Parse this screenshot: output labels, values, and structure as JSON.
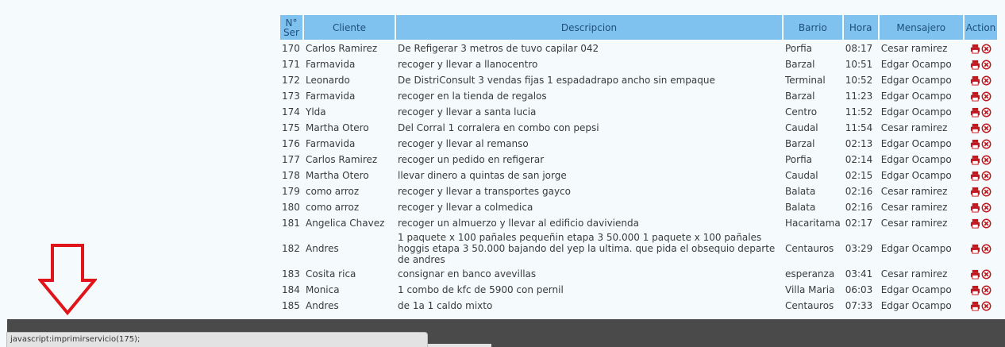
{
  "table": {
    "headers": {
      "ser_line1": "N°",
      "ser_line2": "Ser",
      "cliente": "Cliente",
      "descripcion": "Descripcion",
      "barrio": "Barrio",
      "hora": "Hora",
      "mensajero": "Mensajero",
      "action": "Action"
    },
    "rows": [
      {
        "num": "170",
        "cliente": "Carlos Ramirez",
        "descripcion": "De Refigerar 3 metros de tuvo capilar 042",
        "barrio": "Porfia",
        "hora": "08:17",
        "mensajero": "Cesar ramirez"
      },
      {
        "num": "171",
        "cliente": "Farmavida",
        "descripcion": "recoger y llevar a llanocentro",
        "barrio": "Barzal",
        "hora": "10:51",
        "mensajero": "Edgar Ocampo"
      },
      {
        "num": "172",
        "cliente": "Leonardo",
        "descripcion": "De DistriConsult 3 vendas fijas 1 espadadrapo ancho sin empaque",
        "barrio": "Terminal",
        "hora": "10:52",
        "mensajero": "Edgar Ocampo"
      },
      {
        "num": "173",
        "cliente": "Farmavida",
        "descripcion": "recoger en la tienda de regalos",
        "barrio": "Barzal",
        "hora": "11:23",
        "mensajero": "Edgar Ocampo"
      },
      {
        "num": "174",
        "cliente": "Ylda",
        "descripcion": "recoger y llevar a santa lucia",
        "barrio": "Centro",
        "hora": "11:52",
        "mensajero": "Edgar Ocampo"
      },
      {
        "num": "175",
        "cliente": "Martha Otero",
        "descripcion": "Del Corral 1 corralera en combo con pepsi",
        "barrio": "Caudal",
        "hora": "11:54",
        "mensajero": "Cesar ramirez"
      },
      {
        "num": "176",
        "cliente": "Farmavida",
        "descripcion": "recoger y llevar al remanso",
        "barrio": "Barzal",
        "hora": "02:13",
        "mensajero": "Edgar Ocampo"
      },
      {
        "num": "177",
        "cliente": "Carlos Ramirez",
        "descripcion": "recoger un pedido en refigerar",
        "barrio": "Porfia",
        "hora": "02:14",
        "mensajero": "Edgar Ocampo"
      },
      {
        "num": "178",
        "cliente": "Martha Otero",
        "descripcion": "llevar dinero a quintas de san jorge",
        "barrio": "Caudal",
        "hora": "02:15",
        "mensajero": "Edgar Ocampo"
      },
      {
        "num": "179",
        "cliente": "como arroz",
        "descripcion": "recoger y llevar a transportes gayco",
        "barrio": "Balata",
        "hora": "02:16",
        "mensajero": "Cesar ramirez"
      },
      {
        "num": "180",
        "cliente": "como arroz",
        "descripcion": "recoger y llevar a colmedica",
        "barrio": "Balata",
        "hora": "02:16",
        "mensajero": "Cesar ramirez"
      },
      {
        "num": "181",
        "cliente": "Angelica Chavez",
        "descripcion": "recoger un almuerzo y llevar al edificio davivienda",
        "barrio": "Hacaritama",
        "hora": "02:17",
        "mensajero": "Cesar ramirez"
      },
      {
        "num": "182",
        "cliente": "Andres",
        "descripcion": "1 paquete x 100 pañales pequeñin etapa 3 50.000 1 paquete x 100 pañales hoggis etapa 3 50.000 bajando del yep la ultima. que pida el obsequio departe de andres",
        "barrio": "Centauros",
        "hora": "03:29",
        "mensajero": "Edgar Ocampo"
      },
      {
        "num": "183",
        "cliente": "Cosita rica",
        "descripcion": "consignar en banco avevillas",
        "barrio": "esperanza",
        "hora": "03:41",
        "mensajero": "Cesar ramirez"
      },
      {
        "num": "184",
        "cliente": "Monica",
        "descripcion": "1 combo de kfc de 5900 con pernil",
        "barrio": "Villa Maria",
        "hora": "06:03",
        "mensajero": "Edgar Ocampo"
      },
      {
        "num": "185",
        "cliente": "Andres",
        "descripcion": "de 1a 1 caldo mixto",
        "barrio": "Centauros",
        "hora": "07:33",
        "mensajero": "Edgar Ocampo"
      }
    ],
    "action_icons": [
      "print-icon",
      "cancel-icon"
    ]
  },
  "status_bar": {
    "text": "javascript:imprimirservicio(175);"
  },
  "colors": {
    "header_bg": "#7fc2ef",
    "header_text": "#1f4f7a",
    "page_bg": "#f5fbfd",
    "icon_red": "#c0181f",
    "arrow_red": "#e0141b",
    "taskbar": "#4a4a4a"
  }
}
